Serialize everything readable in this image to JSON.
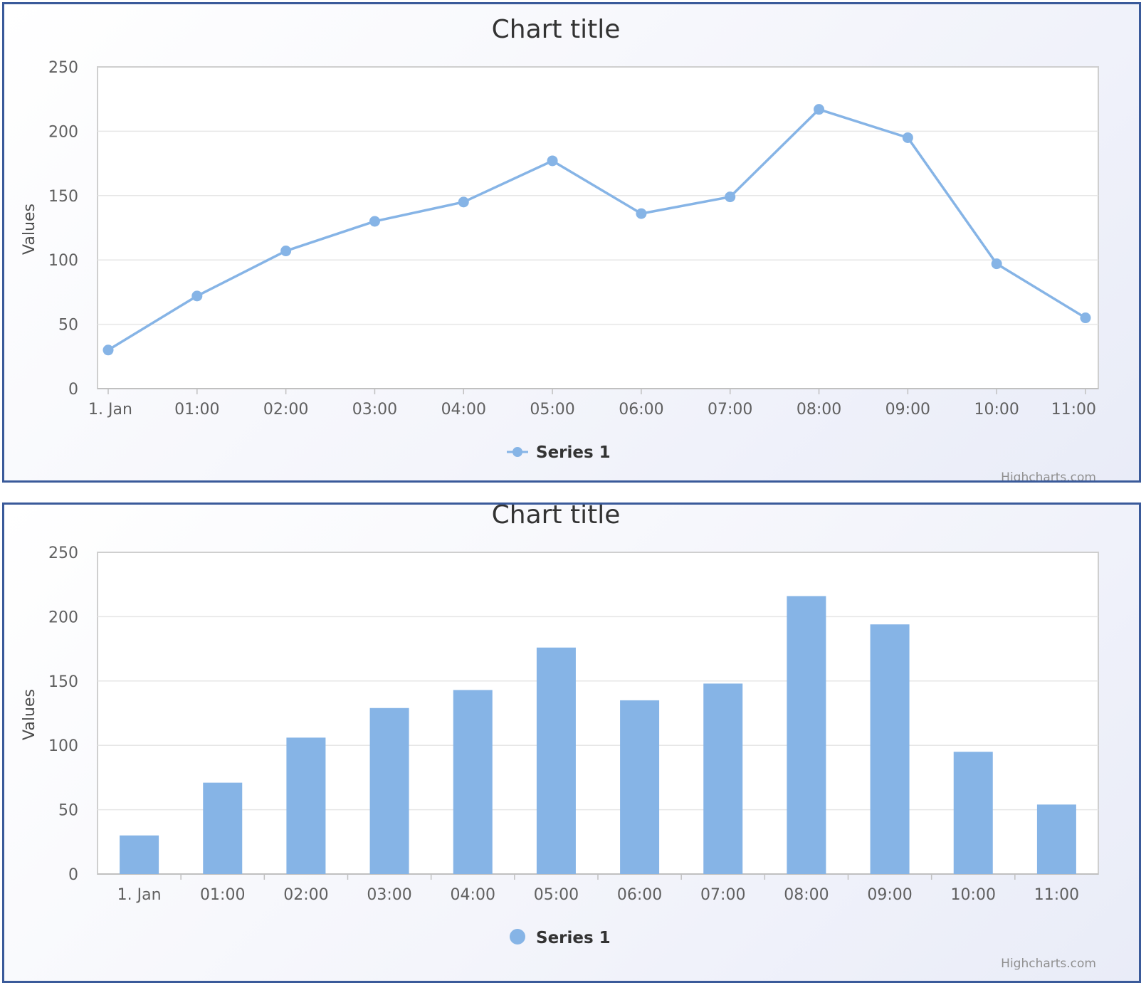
{
  "chart_data": [
    {
      "type": "line",
      "title": "Chart title",
      "ylabel": "Values",
      "xlabel": "",
      "ylim": [
        0,
        250
      ],
      "y_ticks": [
        "0",
        "50",
        "100",
        "150",
        "200",
        "250"
      ],
      "categories": [
        "1. Jan",
        "01:00",
        "02:00",
        "03:00",
        "04:00",
        "05:00",
        "06:00",
        "07:00",
        "08:00",
        "09:00",
        "10:00",
        "11:00"
      ],
      "series": [
        {
          "name": "Series 1",
          "values": [
            30,
            72,
            107,
            130,
            145,
            177,
            136,
            149,
            217,
            195,
            97,
            55
          ]
        }
      ],
      "legend_position": "bottom-center",
      "grid": true,
      "credits": "Highcharts.com",
      "color": "#86b4e6"
    },
    {
      "type": "bar",
      "title": "Chart title",
      "ylabel": "Values",
      "xlabel": "",
      "ylim": [
        0,
        250
      ],
      "y_ticks": [
        "0",
        "50",
        "100",
        "150",
        "200",
        "250"
      ],
      "categories": [
        "1. Jan",
        "01:00",
        "02:00",
        "03:00",
        "04:00",
        "05:00",
        "06:00",
        "07:00",
        "08:00",
        "09:00",
        "10:00",
        "11:00"
      ],
      "series": [
        {
          "name": "Series 1",
          "values": [
            30,
            71,
            106,
            129,
            143,
            176,
            135,
            148,
            216,
            194,
            95,
            54
          ]
        }
      ],
      "legend_position": "bottom-center",
      "grid": true,
      "credits": "Highcharts.com",
      "color": "#86b4e6"
    }
  ]
}
